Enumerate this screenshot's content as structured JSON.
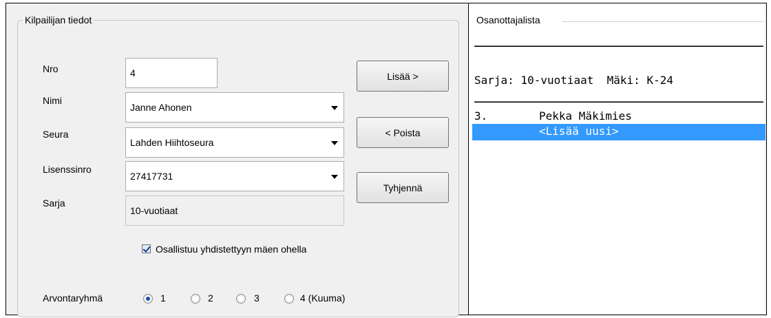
{
  "left": {
    "group_title": "Kilpailijan tiedot",
    "labels": {
      "nro": "Nro",
      "nimi": "Nimi",
      "seura": "Seura",
      "lisenssinro": "Lisenssinro",
      "sarja": "Sarja"
    },
    "values": {
      "nro": "4",
      "nimi": "Janne Ahonen",
      "seura": "Lahden Hiihtoseura",
      "lisenssinro": "27417731",
      "sarja": "10-vuotiaat"
    },
    "buttons": {
      "add": "Lisää >",
      "remove": "< Poista",
      "clear": "Tyhjennä"
    },
    "checkbox": {
      "label": "Osallistuu yhdistettyyn mäen ohella",
      "checked": true
    },
    "radio_group": {
      "label": "Arvontaryhmä",
      "options": [
        "1",
        "2",
        "3",
        "4 (Kuuma)"
      ],
      "selected": "1"
    }
  },
  "right": {
    "title": "Osanottajalista",
    "header_line": "Sarja: 10-vuotiaat  Mäki: K-24",
    "entries": [
      {
        "num": "3.",
        "name": "Pekka Mäkimies"
      }
    ],
    "add_new": "<Lisää uusi>"
  }
}
